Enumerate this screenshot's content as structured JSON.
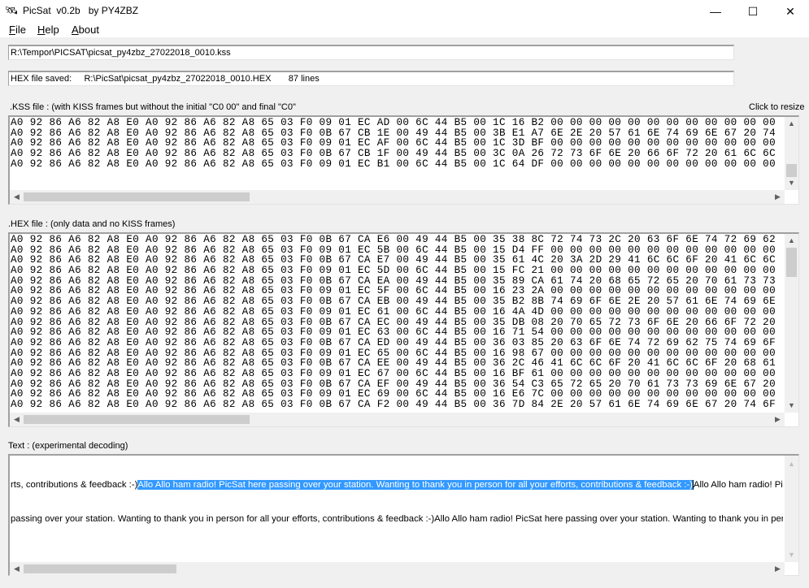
{
  "window": {
    "title": "PicSat  v0.2b   by PY4ZBZ",
    "minimize": "—",
    "maximize": "☐",
    "close": "✕"
  },
  "menu": [
    {
      "label": "File",
      "key": "F",
      "rest": "ile"
    },
    {
      "label": "Help",
      "key": "H",
      "rest": "elp"
    },
    {
      "label": "About",
      "key": "A",
      "rest": "bout"
    }
  ],
  "kss_path": "R:\\Tempor\\PICSAT\\picsat_py4zbz_27022018_0010.kss",
  "hex_status": "HEX file saved:     R:\\PicSat\\picsat_py4zbz_27022018_0010.HEX       87 lines",
  "kss_label": ".KSS file : (with KISS frames but without the initial \"C0 00\" and final \"C0\"",
  "resize_label": "Click to resize",
  "kss_rows": [
    "A0 92 86 A6 82 A8 E0 A0 92 86 A6 82 A8 65 03 F0 09 01 EC AD 00 6C 44 B5 00 1C 16 B2 00 00 00 00 00 00 00 00 00 00 00 00",
    "A0 92 86 A6 82 A8 E0 A0 92 86 A6 82 A8 65 03 F0 0B 67 CB 1E 00 49 44 B5 00 3B E1 A7 6E 2E 20 57 61 6E 74 69 6E 67 20 74",
    "A0 92 86 A6 82 A8 E0 A0 92 86 A6 82 A8 65 03 F0 09 01 EC AF 00 6C 44 B5 00 1C 3D BF 00 00 00 00 00 00 00 00 00 00 00 00",
    "A0 92 86 A6 82 A8 E0 A0 92 86 A6 82 A8 65 03 F0 0B 67 CB 1F 00 49 44 B5 00 3C 0A 26 72 73 6F 6E 20 66 6F 72 20 61 6C 6C",
    "A0 92 86 A6 82 A8 E0 A0 92 86 A6 82 A8 65 03 F0 09 01 EC B1 00 6C 44 B5 00 1C 64 DF 00 00 00 00 00 00 00 00 00 00 00 00"
  ],
  "hex_label": ".HEX file : (only data and no KISS frames)",
  "hex_rows": [
    "A0 92 86 A6 82 A8 E0 A0 92 86 A6 82 A8 65 03 F0 0B 67 CA E6 00 49 44 B5 00 35 38 8C 72 74 73 2C 20 63 6F 6E 74 72 69 62",
    "A0 92 86 A6 82 A8 E0 A0 92 86 A6 82 A8 65 03 F0 09 01 EC 5B 00 6C 44 B5 00 15 D4 FF 00 00 00 00 00 00 00 00 00 00 00 00",
    "A0 92 86 A6 82 A8 E0 A0 92 86 A6 82 A8 65 03 F0 0B 67 CA E7 00 49 44 B5 00 35 61 4C 20 3A 2D 29 41 6C 6C 6F 20 41 6C 6C",
    "A0 92 86 A6 82 A8 E0 A0 92 86 A6 82 A8 65 03 F0 09 01 EC 5D 00 6C 44 B5 00 15 FC 21 00 00 00 00 00 00 00 00 00 00 00 00",
    "A0 92 86 A6 82 A8 E0 A0 92 86 A6 82 A8 65 03 F0 0B 67 CA EA 00 49 44 B5 00 35 89 CA 61 74 20 68 65 72 65 20 70 61 73 73",
    "A0 92 86 A6 82 A8 E0 A0 92 86 A6 82 A8 65 03 F0 09 01 EC 5F 00 6C 44 B5 00 16 23 2A 00 00 00 00 00 00 00 00 00 00 00 00",
    "A0 92 86 A6 82 A8 E0 A0 92 86 A6 82 A8 65 03 F0 0B 67 CA EB 00 49 44 B5 00 35 B2 8B 74 69 6F 6E 2E 20 57 61 6E 74 69 6E",
    "A0 92 86 A6 82 A8 E0 A0 92 86 A6 82 A8 65 03 F0 09 01 EC 61 00 6C 44 B5 00 16 4A 4D 00 00 00 00 00 00 00 00 00 00 00 00",
    "A0 92 86 A6 82 A8 E0 A0 92 86 A6 82 A8 65 03 F0 0B 67 CA EC 00 49 44 B5 00 35 DB 08 20 70 65 72 73 6F 6E 20 66 6F 72 20",
    "A0 92 86 A6 82 A8 E0 A0 92 86 A6 82 A8 65 03 F0 09 01 EC 63 00 6C 44 B5 00 16 71 54 00 00 00 00 00 00 00 00 00 00 00 00",
    "A0 92 86 A6 82 A8 E0 A0 92 86 A6 82 A8 65 03 F0 0B 67 CA ED 00 49 44 B5 00 36 03 85 20 63 6F 6E 74 72 69 62 75 74 69 6F",
    "A0 92 86 A6 82 A8 E0 A0 92 86 A6 82 A8 65 03 F0 09 01 EC 65 00 6C 44 B5 00 16 98 67 00 00 00 00 00 00 00 00 00 00 00 00",
    "A0 92 86 A6 82 A8 E0 A0 92 86 A6 82 A8 65 03 F0 0B 67 CA EE 00 49 44 B5 00 36 2C 46 41 6C 6C 6F 20 41 6C 6C 6F 20 68 61",
    "A0 92 86 A6 82 A8 E0 A0 92 86 A6 82 A8 65 03 F0 09 01 EC 67 00 6C 44 B5 00 16 BF 61 00 00 00 00 00 00 00 00 00 00 00 00",
    "A0 92 86 A6 82 A8 E0 A0 92 86 A6 82 A8 65 03 F0 0B 67 CA EF 00 49 44 B5 00 36 54 C3 65 72 65 20 70 61 73 73 69 6E 67 20",
    "A0 92 86 A6 82 A8 E0 A0 92 86 A6 82 A8 65 03 F0 09 01 EC 69 00 6C 44 B5 00 16 E6 7C 00 00 00 00 00 00 00 00 00 00 00 00",
    "A0 92 86 A6 82 A8 E0 A0 92 86 A6 82 A8 65 03 F0 0B 67 CA F2 00 49 44 B5 00 36 7D 84 2E 20 57 61 6E 74 69 6E 67 20 74 6F"
  ],
  "text_label": "Text : (experimental decoding)",
  "text": {
    "line1_pre": "rts, contributions & feedback :-)",
    "line1_selected": "Allo Allo ham radio! PicSat here passing over your station. Wanting to thank you in person for all your efforts, contributions & feedback :-)",
    "line1_post": "Allo Allo ham radio! PicSat here pa",
    "line2": "passing over your station. Wanting to thank you in person for all your efforts, contributions & feedback :-)Allo Allo ham radio! PicSat here passing over your station. Wanting to thank you in person for all y"
  },
  "icons": {
    "up": "▲",
    "down": "▼",
    "left": "◀",
    "right": "▶"
  }
}
